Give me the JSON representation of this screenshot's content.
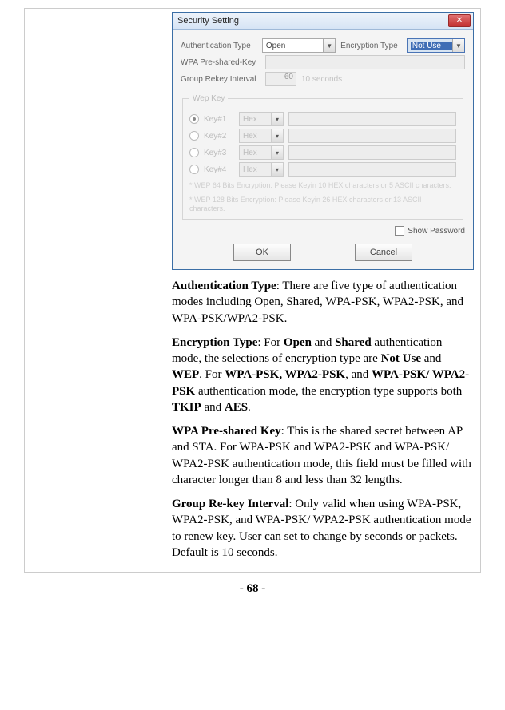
{
  "dialog": {
    "title": "Security Setting",
    "close": "✕",
    "auth_type_label": "Authentication Type",
    "auth_type_value": "Open",
    "enc_type_label": "Encryption Type",
    "enc_type_value": "Not Use",
    "psk_label": "WPA Pre-shared-Key",
    "rekey_label": "Group Rekey Interval",
    "rekey_value": "60",
    "rekey_unit": "10 seconds",
    "wep_legend": "Wep Key",
    "keys": [
      {
        "label": "Key#1",
        "fmt": "Hex",
        "checked": true
      },
      {
        "label": "Key#2",
        "fmt": "Hex",
        "checked": false
      },
      {
        "label": "Key#3",
        "fmt": "Hex",
        "checked": false
      },
      {
        "label": "Key#4",
        "fmt": "Hex",
        "checked": false
      }
    ],
    "wep_note1": "* WEP 64 Bits Encryption:  Please Keyin 10 HEX characters or 5 ASCII characters.",
    "wep_note2": "* WEP 128 Bits Encryption:  Please Keyin 26 HEX characters or 13 ASCII characters.",
    "show_pw": "Show Password",
    "ok": "OK",
    "cancel": "Cancel"
  },
  "doc": {
    "p1_b": "Authentication Type",
    "p1": ": There are five type of authentication modes including Open, Shared, WPA-PSK, WPA2-PSK, and WPA-PSK/WPA2-PSK.",
    "p2_b1": "Encryption Type",
    "p2_a": ": For ",
    "p2_b2": "Open",
    "p2_b": " and ",
    "p2_b3": "Shared",
    "p2_c": " authentication mode, the selections of encryption type are ",
    "p2_b4": "Not Use",
    "p2_d": " and ",
    "p2_b5": "WEP",
    "p2_e": ". For ",
    "p2_b6": "WPA-PSK, WPA2-PSK",
    "p2_f": ", and ",
    "p2_b7": "WPA-PSK/ WPA2-PSK",
    "p2_g": " authentication mode, the encryption type supports both ",
    "p2_b8": "TKIP",
    "p2_h": " and ",
    "p2_b9": "AES",
    "p2_i": ".",
    "p3_b": "WPA Pre-shared Key",
    "p3": ": This is the shared secret between AP and STA. For WPA-PSK and WPA2-PSK and WPA-PSK/ WPA2-PSK authentication mode, this field must be filled with character longer than 8 and less than 32 lengths.",
    "p4_b": "Group Re-key Interval",
    "p4": ": Only valid when using WPA-PSK, WPA2-PSK, and WPA-PSK/ WPA2-PSK authentication mode to renew key. User can set to change by seconds or packets. Default is 10 seconds."
  },
  "page_number": "- 68 -"
}
